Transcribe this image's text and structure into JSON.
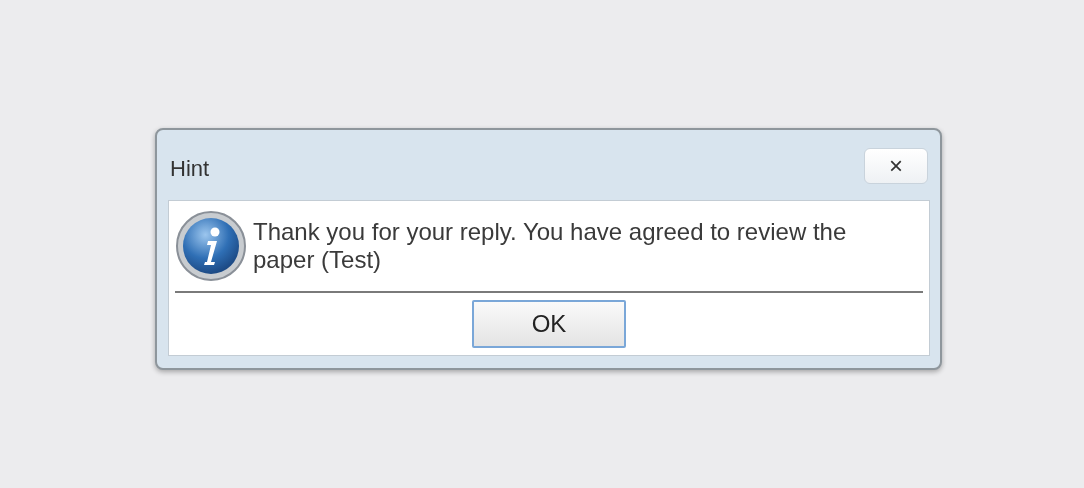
{
  "dialog": {
    "title": "Hint",
    "close_label": "×",
    "message": "Thank you for your reply. You have agreed to review the paper (Test)",
    "buttons": [
      {
        "label": "OK",
        "focused": true
      }
    ]
  }
}
